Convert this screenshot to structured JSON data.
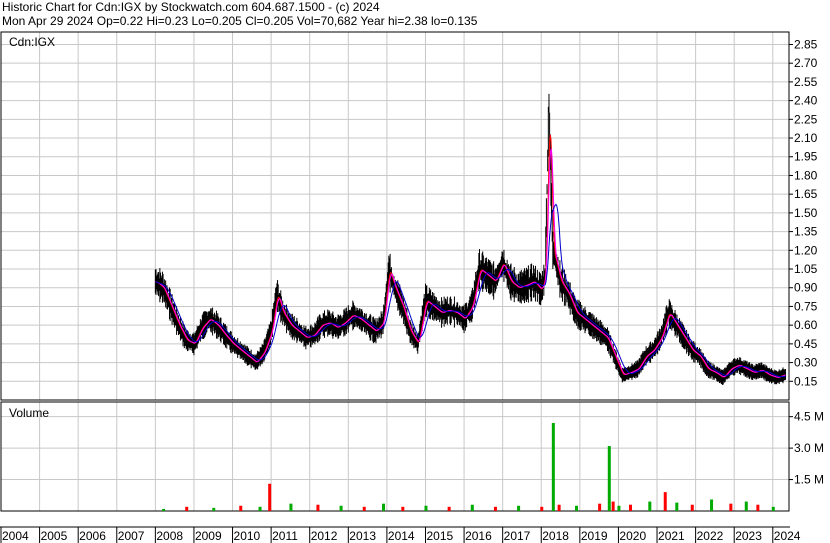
{
  "header": {
    "line1": "Historic Chart for Cdn:IGX by Stockwatch.com 604.687.1500 - (c) 2024",
    "line2": "Mon Apr 29 2024   Op=0.22   Hi=0.23   Lo=0.205   Cl=0.205   Vol=70,682   Year hi=2.38   lo=0.135"
  },
  "price_panel": {
    "label": "Cdn:IGX"
  },
  "volume_panel": {
    "label": "Volume"
  },
  "colors": {
    "price_bars": "#000000",
    "ma_short": "#ff00ff",
    "ma_short2": "#ff0000",
    "ma_long": "#0000cc",
    "vol_up": "#00aa00",
    "vol_down": "#ff0000",
    "grid": "#c8c8c8"
  },
  "chart_data": [
    {
      "type": "line",
      "name": "price",
      "title": "",
      "ylim": [
        0.0,
        2.95
      ],
      "y_ticks": [
        "2.85",
        "2.70",
        "2.55",
        "2.40",
        "2.25",
        "2.10",
        "1.95",
        "1.80",
        "1.65",
        "1.50",
        "1.35",
        "1.20",
        "1.05",
        "0.90",
        "0.75",
        "0.60",
        "0.45",
        "0.30",
        "0.15"
      ],
      "x_ticks": [
        "2004",
        "2005",
        "2006",
        "2007",
        "2008",
        "2009",
        "2010",
        "2011",
        "2012",
        "2013",
        "2014",
        "2015",
        "2016",
        "2017",
        "2018",
        "2019",
        "2020",
        "2021",
        "2022",
        "2023",
        "2024"
      ],
      "series": [
        {
          "x": [
            2008.0,
            2008.2,
            2008.4,
            2008.6,
            2008.8,
            2009.0,
            2009.2,
            2009.4,
            2009.6,
            2009.8,
            2010.0,
            2010.2,
            2010.4,
            2010.6,
            2010.8,
            2011.0,
            2011.15,
            2011.3,
            2011.5,
            2011.7,
            2011.9,
            2012.1,
            2012.3,
            2012.5,
            2012.7,
            2012.9,
            2013.1,
            2013.3,
            2013.5,
            2013.7,
            2013.9,
            2014.05,
            2014.2,
            2014.4,
            2014.6,
            2014.8,
            2015.0,
            2015.2,
            2015.4,
            2015.6,
            2015.8,
            2016.0,
            2016.2,
            2016.4,
            2016.6,
            2016.8,
            2017.0,
            2017.2,
            2017.4,
            2017.6,
            2017.8,
            2018.0,
            2018.1,
            2018.2,
            2018.3,
            2018.5,
            2018.7,
            2018.9,
            2019.1,
            2019.3,
            2019.5,
            2019.7,
            2019.9,
            2020.1,
            2020.3,
            2020.5,
            2020.7,
            2020.9,
            2021.1,
            2021.3,
            2021.5,
            2021.7,
            2021.9,
            2022.1,
            2022.3,
            2022.5,
            2022.7,
            2022.9,
            2023.1,
            2023.3,
            2023.5,
            2023.7,
            2023.9,
            2024.1,
            2024.33
          ],
          "y": [
            0.95,
            0.9,
            0.75,
            0.6,
            0.48,
            0.45,
            0.58,
            0.65,
            0.6,
            0.52,
            0.45,
            0.4,
            0.35,
            0.3,
            0.38,
            0.55,
            0.85,
            0.7,
            0.6,
            0.55,
            0.5,
            0.52,
            0.6,
            0.62,
            0.58,
            0.62,
            0.68,
            0.65,
            0.6,
            0.55,
            0.62,
            1.05,
            0.9,
            0.75,
            0.55,
            0.45,
            0.8,
            0.75,
            0.7,
            0.72,
            0.7,
            0.65,
            0.75,
            1.05,
            1.0,
            0.95,
            1.1,
            0.95,
            0.9,
            0.92,
            0.95,
            0.88,
            1.0,
            2.38,
            1.2,
            0.95,
            0.85,
            0.7,
            0.65,
            0.6,
            0.55,
            0.5,
            0.35,
            0.2,
            0.22,
            0.25,
            0.35,
            0.4,
            0.5,
            0.7,
            0.6,
            0.5,
            0.4,
            0.35,
            0.25,
            0.22,
            0.18,
            0.25,
            0.28,
            0.25,
            0.22,
            0.24,
            0.2,
            0.18,
            0.205
          ]
        }
      ]
    },
    {
      "type": "bar",
      "name": "volume",
      "ylim": [
        0,
        5.2
      ],
      "y_ticks": [
        "4.5 M",
        "3.0 M",
        "1.5 M"
      ],
      "series": [
        {
          "x": [
            2008.2,
            2008.8,
            2009.5,
            2010.2,
            2010.7,
            2010.95,
            2011.5,
            2012.2,
            2012.8,
            2013.4,
            2013.9,
            2014.4,
            2015.0,
            2015.6,
            2016.2,
            2016.8,
            2017.4,
            2018.0,
            2018.3,
            2018.45,
            2018.9,
            2019.5,
            2019.75,
            2019.85,
            2020.0,
            2020.3,
            2020.8,
            2021.2,
            2021.5,
            2021.9,
            2022.4,
            2022.9,
            2023.3,
            2023.6,
            2024.0
          ],
          "y": [
            0.1,
            0.2,
            0.15,
            0.25,
            0.2,
            1.3,
            0.35,
            0.3,
            0.25,
            0.2,
            0.35,
            0.2,
            0.25,
            0.2,
            0.3,
            0.2,
            0.25,
            0.2,
            4.2,
            0.3,
            0.25,
            0.35,
            3.1,
            0.45,
            0.25,
            0.3,
            0.45,
            0.9,
            0.4,
            0.3,
            0.55,
            0.35,
            0.45,
            0.3,
            0.2
          ]
        }
      ]
    }
  ]
}
